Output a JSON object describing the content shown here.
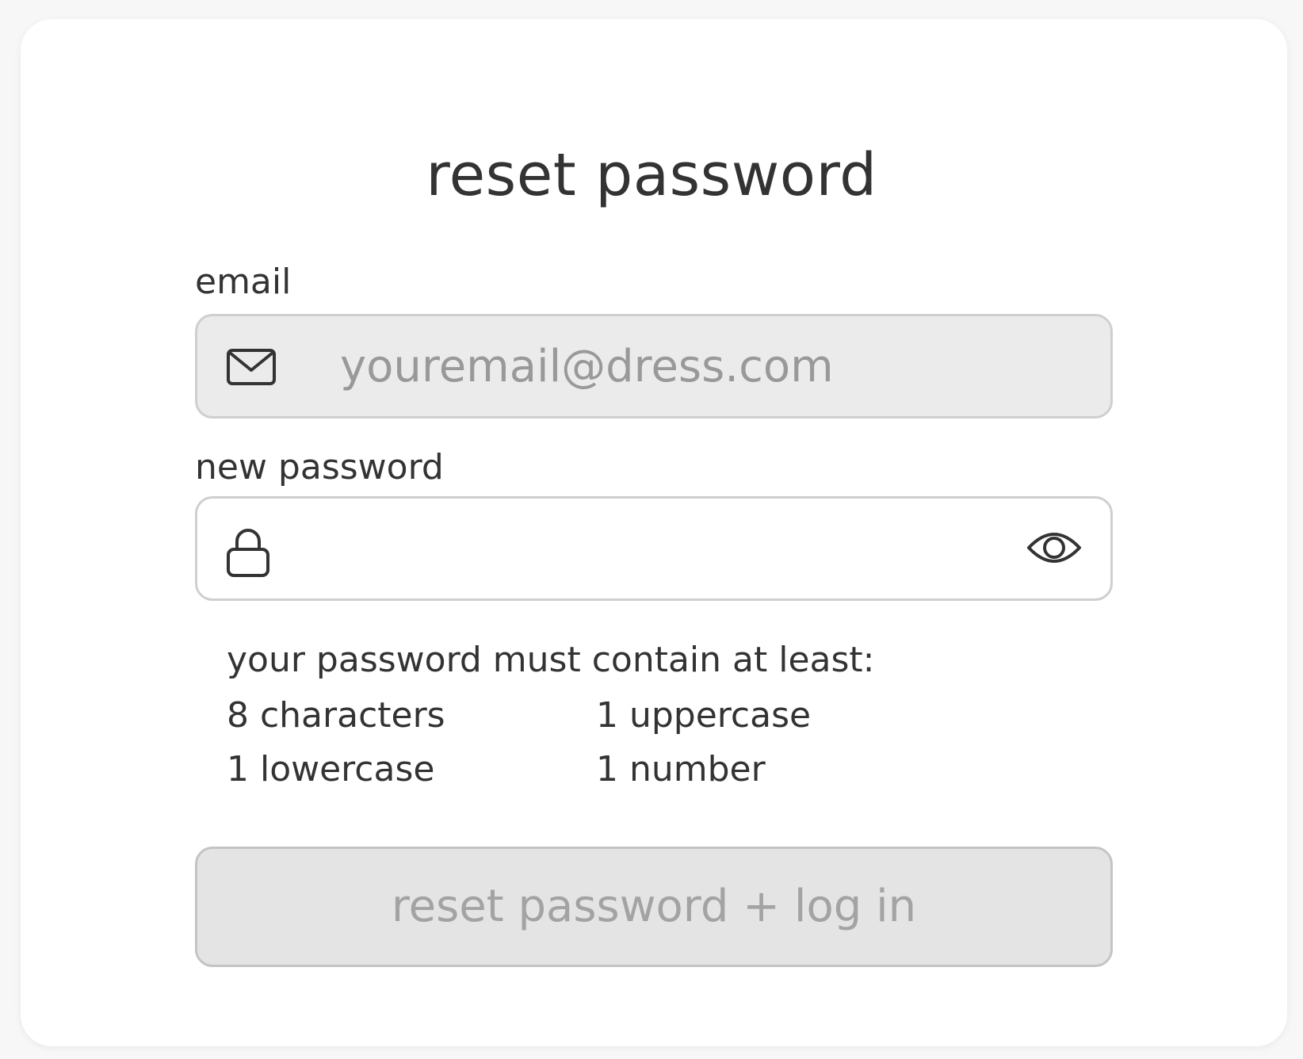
{
  "title": "reset password",
  "email": {
    "label": "email",
    "placeholder": "youremail@dress.com",
    "value": "",
    "icon": "envelope-icon",
    "disabled": true
  },
  "new_password": {
    "label": "new password",
    "value": "",
    "icon": "lock-icon",
    "toggle_icon": "eye-icon"
  },
  "requirements": {
    "heading": "your password must contain at least:",
    "items": [
      "8 characters",
      "1 uppercase",
      "1 lowercase",
      "1 number"
    ]
  },
  "submit": {
    "label": "reset password + log in",
    "disabled": true
  },
  "colors": {
    "text": "#333333",
    "muted_text": "#999999",
    "disabled_field_bg": "#ebebeb",
    "disabled_button_bg": "#e4e4e4",
    "border": "#cfcfcf"
  }
}
